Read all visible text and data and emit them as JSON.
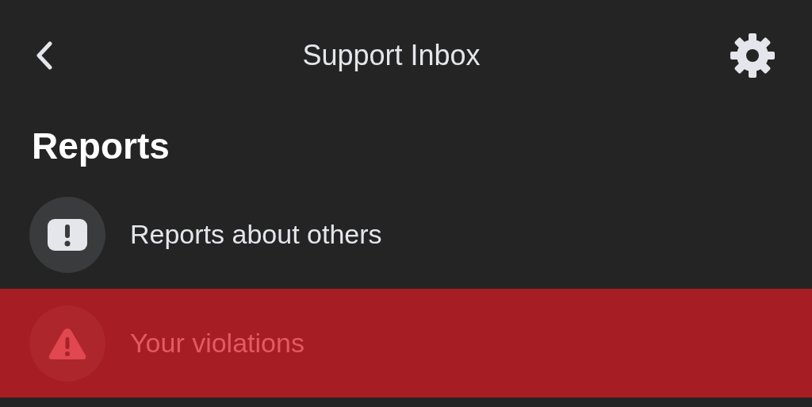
{
  "header": {
    "title": "Support Inbox"
  },
  "section": {
    "title": "Reports"
  },
  "items": [
    {
      "label": "Reports about others",
      "kind": "report",
      "selected": false
    },
    {
      "label": "Your violations",
      "kind": "warning",
      "selected": true
    }
  ]
}
